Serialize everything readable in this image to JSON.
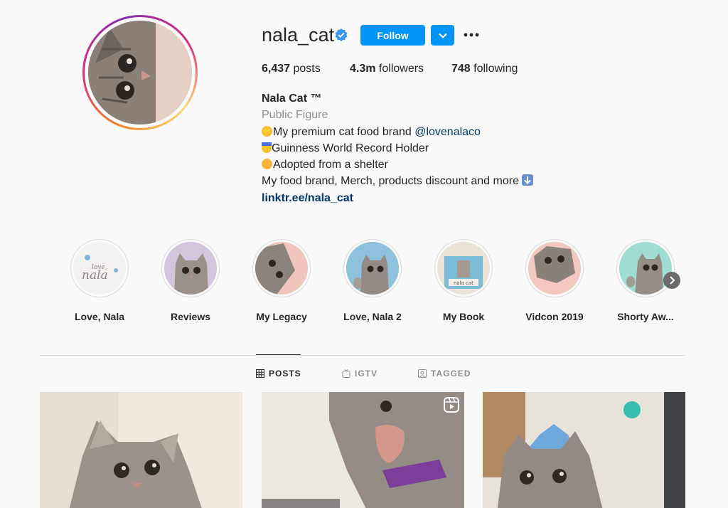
{
  "profile": {
    "username": "nala_cat",
    "follow_label": "Follow",
    "stats": {
      "posts_count": "6,437",
      "posts_label": " posts",
      "followers_count": "4.3m",
      "followers_label": " followers",
      "following_count": "748",
      "following_label": " following"
    },
    "bio": {
      "name": "Nala Cat ™",
      "category": "Public Figure",
      "line1_text": "My premium cat food brand ",
      "line1_mention": "@lovenalaco",
      "line2_text": "Guinness World Record Holder",
      "line3_text": "Adopted from a shelter",
      "line4_text": "My food brand, Merch, products discount and more",
      "link": "linktr.ee/nala_cat"
    }
  },
  "highlights": [
    {
      "label": "Love, Nala"
    },
    {
      "label": "Reviews"
    },
    {
      "label": "My Legacy"
    },
    {
      "label": "Love, Nala 2"
    },
    {
      "label": "My Book"
    },
    {
      "label": "Vidcon 2019"
    },
    {
      "label": "Shorty Aw..."
    }
  ],
  "highlight_logo": {
    "line1": "love,",
    "line2": "nala"
  },
  "book_title": "nala cat",
  "tabs": [
    {
      "label": "POSTS",
      "active": true
    },
    {
      "label": "IGTV",
      "active": false
    },
    {
      "label": "TAGGED",
      "active": false
    }
  ],
  "colors": {
    "accent": "#0095f6",
    "link": "#00376b",
    "text": "#262626",
    "muted": "#8e8e8e"
  }
}
